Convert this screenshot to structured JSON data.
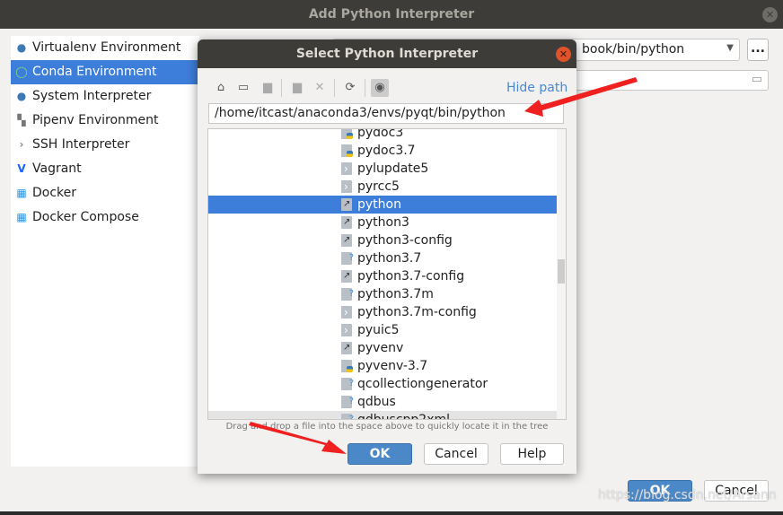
{
  "window": {
    "title": "Add Python Interpreter",
    "close_icon": "close-icon"
  },
  "sidebar": {
    "items": [
      {
        "label": "Virtualenv Environment",
        "icon": "python-icon"
      },
      {
        "label": "Conda Environment",
        "icon": "conda-icon",
        "selected": true
      },
      {
        "label": "System Interpreter",
        "icon": "python-icon"
      },
      {
        "label": "Pipenv Environment",
        "icon": "pipenv-icon"
      },
      {
        "label": "SSH Interpreter",
        "icon": "terminal-icon"
      },
      {
        "label": "Vagrant",
        "icon": "vagrant-icon"
      },
      {
        "label": "Docker",
        "icon": "docker-icon"
      },
      {
        "label": "Docker Compose",
        "icon": "docker-icon"
      }
    ]
  },
  "main": {
    "interpreter_value": "book/bin/python",
    "more_label": "...",
    "ok_label": "OK",
    "cancel_label": "Cancel"
  },
  "dialog": {
    "title": "Select Python Interpreter",
    "hide_path": "Hide path",
    "path": "/home/itcast/anaconda3/envs/pyqt/bin/python",
    "files": [
      {
        "name": "pydoc3",
        "icon": "py"
      },
      {
        "name": "pydoc3.7",
        "icon": "py"
      },
      {
        "name": "pylupdate5",
        "icon": "ex"
      },
      {
        "name": "pyrcc5",
        "icon": "ex"
      },
      {
        "name": "python",
        "icon": "lk",
        "selected": true
      },
      {
        "name": "python3",
        "icon": "lk"
      },
      {
        "name": "python3-config",
        "icon": "lk"
      },
      {
        "name": "python3.7",
        "icon": "q"
      },
      {
        "name": "python3.7-config",
        "icon": "lk"
      },
      {
        "name": "python3.7m",
        "icon": "q"
      },
      {
        "name": "python3.7m-config",
        "icon": "ex"
      },
      {
        "name": "pyuic5",
        "icon": "ex"
      },
      {
        "name": "pyvenv",
        "icon": "lk"
      },
      {
        "name": "pyvenv-3.7",
        "icon": "py"
      },
      {
        "name": "qcollectiongenerator",
        "icon": "q"
      },
      {
        "name": "qdbus",
        "icon": "q"
      },
      {
        "name": "qdbuscpp2xml",
        "icon": "q"
      }
    ],
    "hint": "Drag and drop a file into the space above to quickly locate it in the tree",
    "ok_label": "OK",
    "cancel_label": "Cancel",
    "help_label": "Help"
  },
  "watermark": "https://blog.csdn.net/Arsann",
  "colors": {
    "accent": "#3d7edb",
    "primary_button": "#4a88c7",
    "annotation_arrow": "#f02020"
  }
}
